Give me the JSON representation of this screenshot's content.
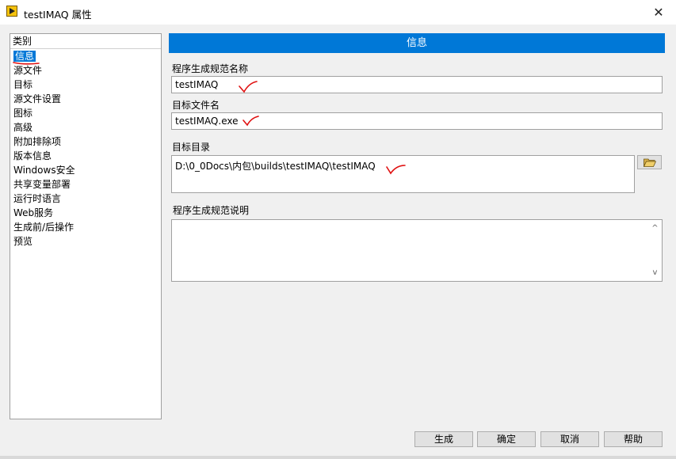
{
  "window": {
    "title": "testIMAQ 属性",
    "close_glyph": "✕"
  },
  "sidebar": {
    "header": "类别",
    "items": [
      {
        "label": "信息",
        "selected": true
      },
      {
        "label": "源文件"
      },
      {
        "label": "目标"
      },
      {
        "label": "源文件设置"
      },
      {
        "label": "图标"
      },
      {
        "label": "高级"
      },
      {
        "label": "附加排除项"
      },
      {
        "label": "版本信息"
      },
      {
        "label": "Windows安全"
      },
      {
        "label": "共享变量部署"
      },
      {
        "label": "运行时语言"
      },
      {
        "label": "Web服务"
      },
      {
        "label": "生成前/后操作"
      },
      {
        "label": "预览"
      }
    ]
  },
  "main": {
    "section_title": "信息",
    "spec_name_label": "程序生成规范名称",
    "spec_name_value": "testIMAQ",
    "target_file_label": "目标文件名",
    "target_file_value": "testIMAQ.exe",
    "target_dir_label": "目标目录",
    "target_dir_value": "D:\\0_0Docs\\内包\\builds\\testIMAQ\\testIMAQ",
    "description_label": "程序生成规范说明",
    "description_value": "",
    "scroll_up_glyph": "^",
    "scroll_down_glyph": "v"
  },
  "footer": {
    "build_label": "生成",
    "ok_label": "确定",
    "cancel_label": "取消",
    "help_label": "帮助"
  },
  "colors": {
    "accent": "#0078d7",
    "annotation_red": "#e01010"
  },
  "icons": {
    "app": "labview-project-icon",
    "browse": "folder-open-icon"
  }
}
